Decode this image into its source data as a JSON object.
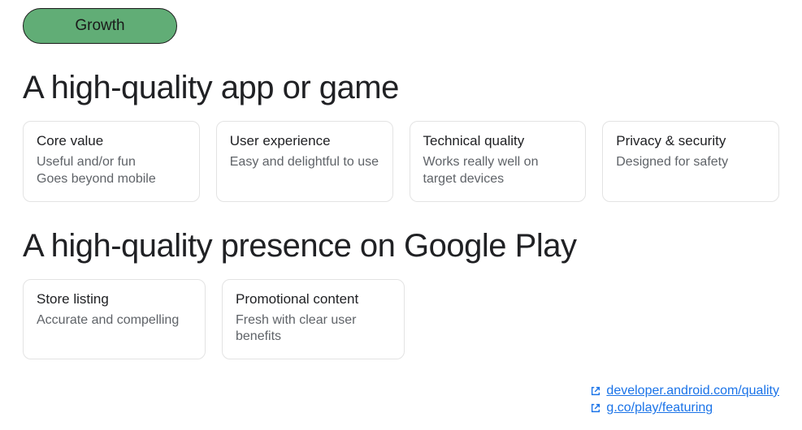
{
  "pill": {
    "label": "Growth",
    "bg": "#61ad76",
    "fg": "#1a1a1a"
  },
  "section1": {
    "heading": "A high-quality app or game",
    "cards": [
      {
        "title": "Core value",
        "body": "Useful and/or fun\nGoes beyond mobile"
      },
      {
        "title": "User experience",
        "body": "Easy and delightful to use"
      },
      {
        "title": "Technical quality",
        "body": "Works really well on target devices"
      },
      {
        "title": "Privacy & security",
        "body": "Designed for safety"
      }
    ]
  },
  "section2": {
    "heading": "A high-quality presence on Google Play",
    "cards": [
      {
        "title": "Store listing",
        "body": "Accurate and compelling"
      },
      {
        "title": "Promotional content",
        "body": "Fresh with clear user benefits"
      }
    ]
  },
  "links": [
    {
      "text": "developer.android.com/quality"
    },
    {
      "text": "g.co/play/featuring"
    }
  ]
}
